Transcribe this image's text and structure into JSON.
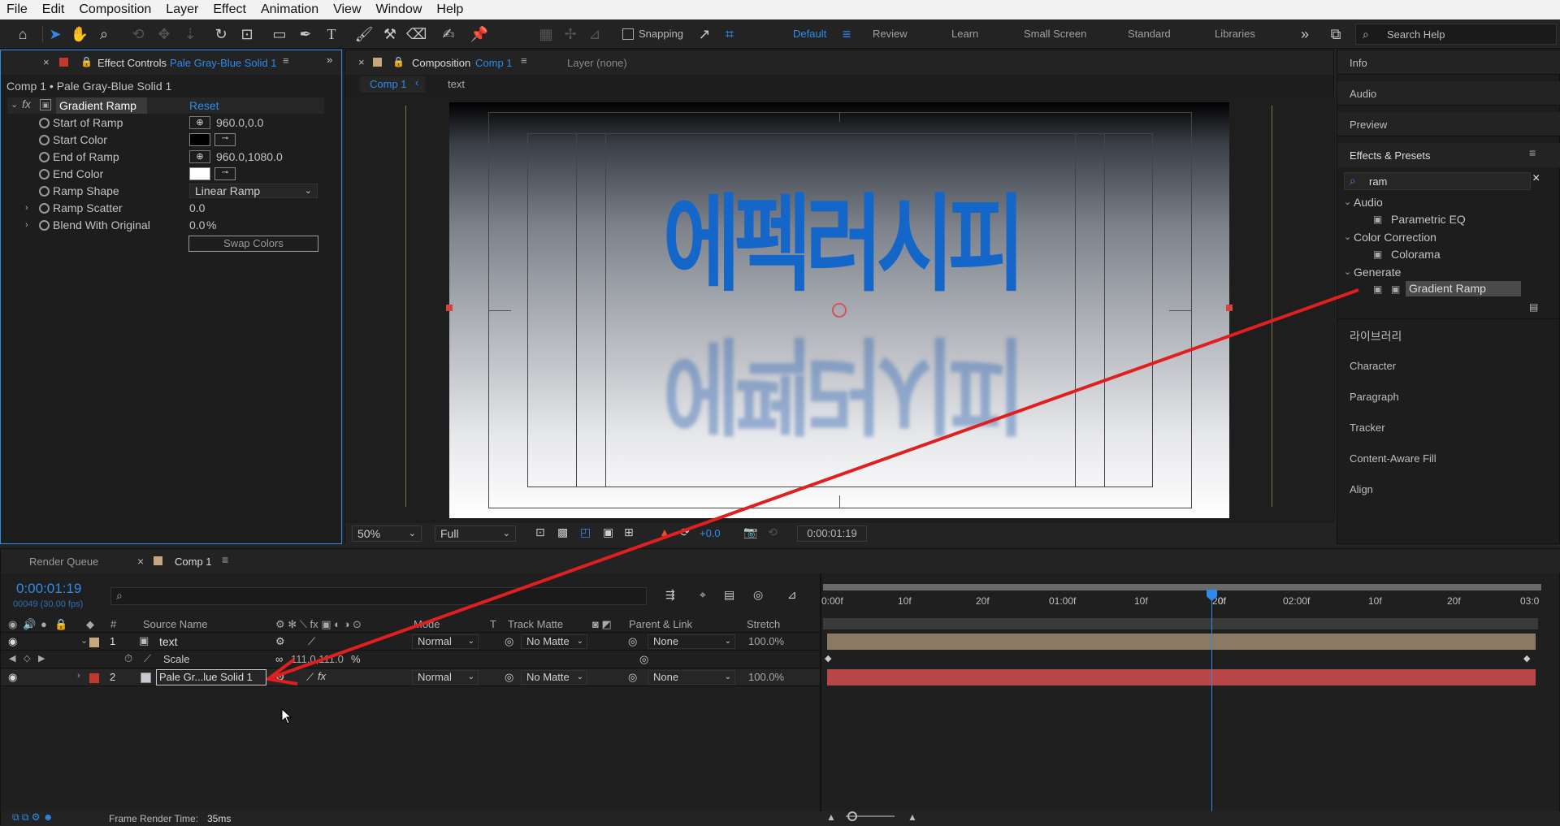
{
  "menu": [
    "File",
    "Edit",
    "Composition",
    "Layer",
    "Effect",
    "Animation",
    "View",
    "Window",
    "Help"
  ],
  "toolbar": {
    "snapping": "Snapping",
    "workspaces": [
      "Default",
      "Review",
      "Learn",
      "Small Screen",
      "Standard",
      "Libraries"
    ],
    "active_workspace": "Default",
    "search_placeholder": "Search Help"
  },
  "effect_controls": {
    "tab_label": "Effect Controls",
    "tab_layer": "Pale Gray-Blue Solid 1",
    "breadcrumb": "Comp 1 • Pale Gray-Blue Solid 1",
    "effect_name": "Gradient Ramp",
    "reset": "Reset",
    "props": {
      "start_of_ramp": {
        "label": "Start of Ramp",
        "value": "960.0,0.0"
      },
      "start_color": {
        "label": "Start Color"
      },
      "end_of_ramp": {
        "label": "End of Ramp",
        "value": "960.0,1080.0"
      },
      "end_color": {
        "label": "End Color"
      },
      "ramp_shape": {
        "label": "Ramp Shape",
        "value": "Linear Ramp"
      },
      "ramp_scatter": {
        "label": "Ramp Scatter",
        "value": "0.0"
      },
      "blend": {
        "label": "Blend With Original",
        "value": "0.0",
        "unit": "%"
      }
    },
    "swap_colors": "Swap Colors"
  },
  "composition": {
    "tab_label": "Composition",
    "tab_comp": "Comp 1",
    "layer_tab": "Layer (none)",
    "crumb_comp": "Comp 1",
    "crumb_layer": "text",
    "text_top": "에펙러시피",
    "text_reflect": "에펙러시피",
    "zoom": "50%",
    "quality": "Full",
    "exposure": "+0.0",
    "timecode": "0:00:01:19"
  },
  "right_panel": {
    "info": "Info",
    "audio": "Audio",
    "preview": "Preview",
    "effects_presets": "Effects & Presets",
    "search_value": "ram",
    "tree": {
      "audio": "Audio",
      "parametric_eq": "Parametric EQ",
      "color_correction": "Color Correction",
      "colorama": "Colorama",
      "generate": "Generate",
      "gradient_ramp": "Gradient Ramp"
    },
    "library": "라이브러리",
    "character": "Character",
    "paragraph": "Paragraph",
    "tracker": "Tracker",
    "content_aware": "Content-Aware Fill",
    "align": "Align"
  },
  "timeline": {
    "render_queue": "Render Queue",
    "comp_tab": "Comp 1",
    "timecode": "0:00:01:19",
    "frame_info": "00049 (30.00 fps)",
    "columns": {
      "hash": "#",
      "source_name": "Source Name",
      "mode": "Mode",
      "t": "T",
      "track_matte": "Track Matte",
      "parent": "Parent & Link",
      "stretch": "Stretch"
    },
    "layers": [
      {
        "num": "1",
        "name": "text",
        "mode": "Normal",
        "matte": "No Matte",
        "parent": "None",
        "stretch": "100.0%"
      },
      {
        "num": "2",
        "name": "Pale Gr...lue Solid 1",
        "mode": "Normal",
        "matte": "No Matte",
        "parent": "None",
        "stretch": "100.0%"
      }
    ],
    "scale_label": "Scale",
    "scale_value": "111.0,111.0",
    "scale_unit": "%",
    "ruler": [
      "0:00f",
      "10f",
      "20f",
      "01:00f",
      "10f",
      "20f",
      "0f",
      "02:00f",
      "10f",
      "20f",
      "03:0"
    ],
    "frame_render_label": "Frame Render Time:",
    "frame_render_value": "35ms"
  },
  "colors": {
    "accent": "#2d8ceb",
    "layer1_label": "#c9a77c",
    "layer2_label": "#c0392b",
    "annotation": "#e02020"
  }
}
